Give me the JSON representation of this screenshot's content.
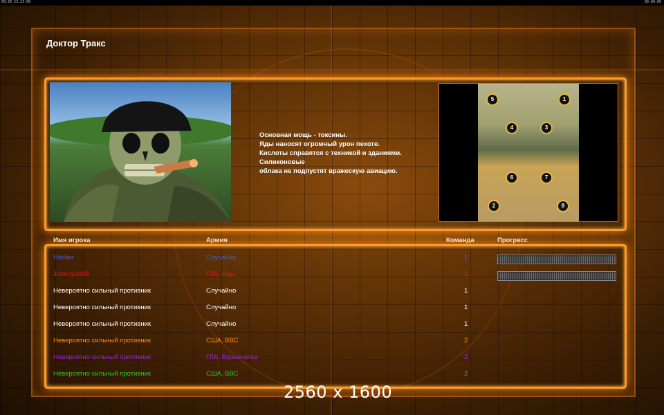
{
  "topbar": {
    "left_text": "00:30 23:23:00",
    "right_text": "00:00:00"
  },
  "title": "Доктор Тракс",
  "description": [
    "Основная мощь - токсины.",
    "Яды наносят огромный урон пехоте.",
    "Кислоты справятся с техникой и зданиями.",
    "Силиконовые",
    "облака не подпустят вражескую авиацию."
  ],
  "minimap": {
    "slots": [
      "1",
      "2",
      "3",
      "4",
      "5",
      "6",
      "7",
      "8"
    ]
  },
  "headers": {
    "player": "Имя игрока",
    "army": "Армия",
    "team": "Команда",
    "progress": "Прогресс"
  },
  "players": [
    {
      "name": "Hitsher",
      "army": "Случайно",
      "team": "1",
      "color": "#3a5fe0",
      "progress": 1.0
    },
    {
      "name": "Johnny2008",
      "army": "ГЛА, Яды",
      "team": "2",
      "color": "#e01818",
      "progress": 1.0
    },
    {
      "name": "Невероятно сильный противник",
      "army": "Случайно",
      "team": "1",
      "color": "#ffffff"
    },
    {
      "name": "Невероятно сильный противник",
      "army": "Случайно",
      "team": "1",
      "color": "#ffffff"
    },
    {
      "name": "Невероятно сильный противник",
      "army": "Случайно",
      "team": "1",
      "color": "#ffffff"
    },
    {
      "name": "Невероятно сильный противник",
      "army": "США, ВВС",
      "team": "2",
      "color": "#ff8c1a"
    },
    {
      "name": "Невероятно сильный противник",
      "army": "ГЛА, Взрывчатка",
      "team": "2",
      "color": "#a020e0"
    },
    {
      "name": "Невероятно сильный противник",
      "army": "США, ВВС",
      "team": "2",
      "color": "#28c828"
    }
  ],
  "overlay_text": "2560 x 1600"
}
